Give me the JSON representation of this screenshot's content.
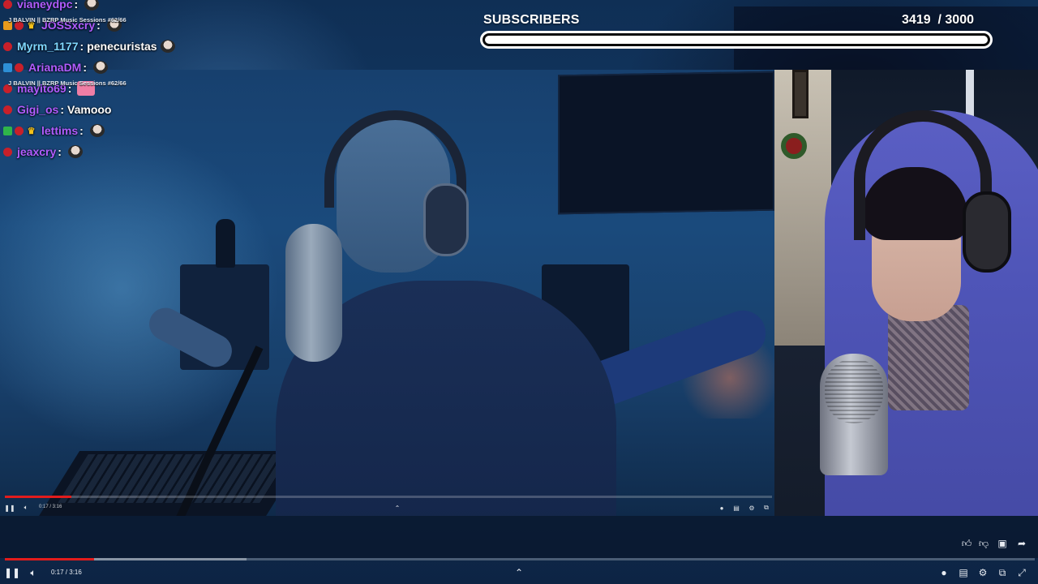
{
  "goal": {
    "label": "SUBSCRIBERS",
    "current": "3419",
    "target": "3000",
    "count_text": "3419  / 3000",
    "fill_fraction": 1.0
  },
  "chat": {
    "messages": [
      {
        "user": "vianeydpc",
        "color": "#b15cff",
        "badges": [
          "sub"
        ],
        "text": "",
        "emote": "face"
      },
      {
        "user": "JOSSxcry",
        "color": "#b15cff",
        "badges": [
          "gift",
          "sub",
          "crown"
        ],
        "text": "",
        "emote": "face"
      },
      {
        "user": "Myrm_1177",
        "color": "#7fd8ff",
        "badges": [
          "sub"
        ],
        "text": "penecuristas",
        "emote": "face"
      },
      {
        "user": "ArianaDM",
        "color": "#b15cff",
        "badges": [
          "turbo",
          "sub"
        ],
        "text": "",
        "emote": "face"
      },
      {
        "user": "mayito69",
        "color": "#b15cff",
        "badges": [
          "sub"
        ],
        "text": "",
        "emote": "pink"
      },
      {
        "user": "Gigi_os",
        "color": "#b15cff",
        "badges": [
          "sub"
        ],
        "text": "Vamooo",
        "emote": ""
      },
      {
        "user": "lettims",
        "color": "#b15cff",
        "badges": [
          "prime",
          "sub",
          "crown"
        ],
        "text": "",
        "emote": "face"
      },
      {
        "user": "jeaxcry",
        "color": "#b15cff",
        "badges": [
          "sub"
        ],
        "text": "",
        "emote": "face"
      }
    ],
    "now_playing": "J BALVIN || BZRP Music Sessions #62/66"
  },
  "inner_player": {
    "time": "0:17 / 3:16",
    "progress_fraction": 0.087
  },
  "outer_player": {
    "time": "0:17 / 3:16",
    "progress_fraction": 0.087,
    "buffer_fraction": 0.235
  },
  "icons": {
    "play_pause": "pause-icon",
    "volume": "volume-icon",
    "chevron": "chevron-up-icon",
    "like": "thumbs-up-icon",
    "dislike": "thumbs-down-icon",
    "comment": "comment-icon",
    "share": "share-icon",
    "autoplay": "autoplay-toggle-icon",
    "captions": "captions-icon",
    "settings": "gear-icon",
    "cast": "cast-icon",
    "fullscreen": "fullscreen-icon"
  },
  "colors": {
    "progress": "#e21c1c",
    "goal_bar": "#ffffff"
  }
}
